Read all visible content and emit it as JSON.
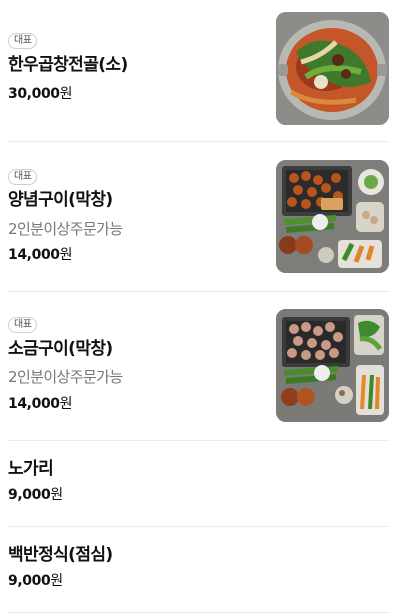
{
  "currency_suffix": "원",
  "items": [
    {
      "badge": "대표",
      "name": "한우곱창전골(소)",
      "description": "",
      "price": "30,000",
      "image": "hot-pot-photo"
    },
    {
      "badge": "대표",
      "name": "양념구이(막창)",
      "description": "2인분이상주문가능",
      "price": "14,000",
      "image": "marinated-grill-photo"
    },
    {
      "badge": "대표",
      "name": "소금구이(막창)",
      "description": "2인분이상주문가능",
      "price": "14,000",
      "image": "salt-grill-photo"
    },
    {
      "badge": "",
      "name": "노가리",
      "description": "",
      "price": "9,000",
      "image": ""
    },
    {
      "badge": "",
      "name": "백반정식(점심)",
      "description": "",
      "price": "9,000",
      "image": ""
    }
  ]
}
